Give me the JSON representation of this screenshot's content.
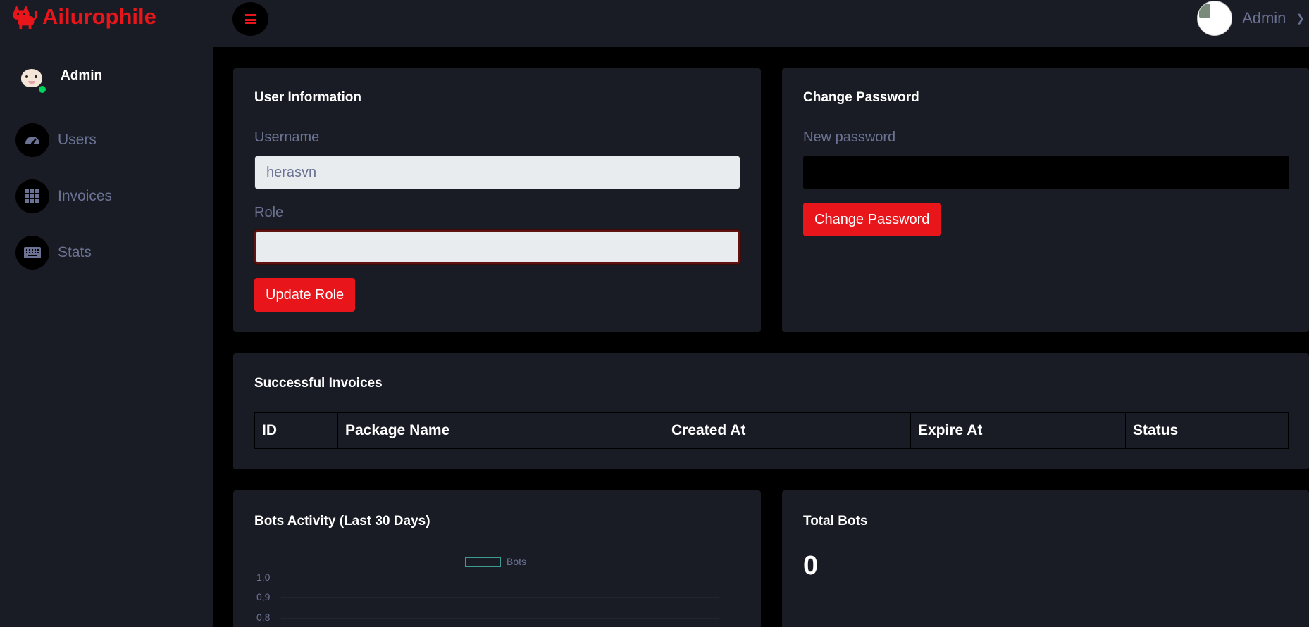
{
  "brand": {
    "name": "Ailurophile",
    "color": "#e8151b",
    "icon": "cat-logo-icon"
  },
  "topbar": {
    "user_name": "Admin",
    "menu_icon": "hamburger-icon",
    "dropdown_icon": "chevron-down-icon"
  },
  "sidebar": {
    "profile_name": "Admin",
    "status": "online",
    "items": [
      {
        "label": "Users",
        "icon": "speedometer-icon"
      },
      {
        "label": "Invoices",
        "icon": "grid-icon"
      },
      {
        "label": "Stats",
        "icon": "keyboard-icon"
      }
    ]
  },
  "user_info": {
    "title": "User Information",
    "username_label": "Username",
    "username_value": "herasvn",
    "role_label": "Role",
    "role_value": "",
    "update_button": "Update Role"
  },
  "change_password": {
    "title": "Change Password",
    "new_password_label": "New password",
    "new_password_value": "",
    "button": "Change Password"
  },
  "invoices": {
    "title": "Successful Invoices",
    "columns": [
      "ID",
      "Package Name",
      "Created At",
      "Expire At",
      "Status"
    ],
    "rows": []
  },
  "bots_activity": {
    "title": "Bots Activity (Last 30 Days)"
  },
  "chart_data": {
    "type": "line",
    "series": [
      {
        "name": "Bots",
        "values": []
      }
    ],
    "y_ticks": [
      "1,0",
      "0,9",
      "0,8"
    ],
    "legend_position": "top-center",
    "series_color": "#3e9c94"
  },
  "total_bots": {
    "title": "Total Bots",
    "value": "0"
  },
  "colors": {
    "accent": "#e8151b",
    "card_bg": "#191c24",
    "page_bg": "#000000",
    "muted_text": "#6c7293"
  }
}
